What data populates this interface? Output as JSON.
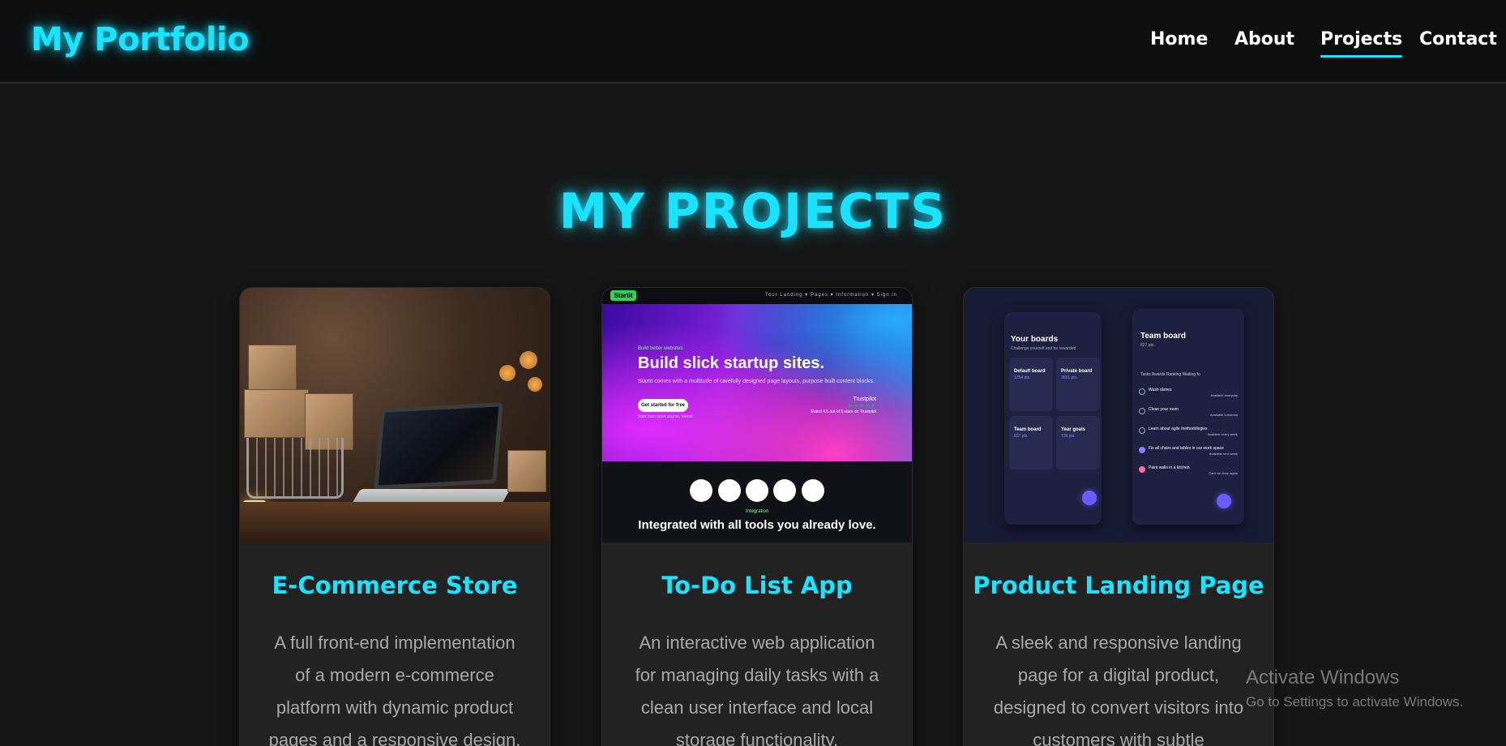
{
  "header": {
    "logo": "My Portfolio",
    "nav": [
      {
        "label": "Home",
        "active": false
      },
      {
        "label": "About",
        "active": false
      },
      {
        "label": "Projects",
        "active": true
      },
      {
        "label": "Contact",
        "active": false
      }
    ]
  },
  "section": {
    "title": "MY PROJECTS"
  },
  "projects": [
    {
      "title": "E-Commerce Store",
      "description": "A full front-end implementation of a modern e-commerce platform with dynamic product pages and a responsive design.",
      "image": "ecommerce-laptop-shopping-cart-photo"
    },
    {
      "title": "To-Do List App",
      "description": "An interactive web application for managing daily tasks with a clean user interface and local storage functionality.",
      "image": "startup-landing-page-screenshot",
      "preview": {
        "logo": "Startit",
        "links": "Tour   Landing ▾   Pages ▾   Information ▾      Sign in",
        "kicker": "Build better websites",
        "headline": "Build slick startup sites.",
        "paragraph": "Startit comes with a multitude of carefully designed page layouts, purpose built content blocks.",
        "button": "Get started for free",
        "small": "Start from open source, Vercel",
        "trust_label": "Trustpilot",
        "trust_stars": "★★★★★",
        "trust_note": "Rated 4.5 out of 5 stars on Trustpilot",
        "integration_kicker": "Integration",
        "integration_heading": "Integrated with all tools you already love."
      }
    },
    {
      "title": "Product Landing Page",
      "description": "A sleek and responsive landing page for a digital product, designed to convert visitors into customers with subtle",
      "image": "boards-app-ui-screenshot",
      "preview": {
        "left_title": "Your boards",
        "left_sub": "Challenge yourself and be rewarded",
        "boards": [
          {
            "name": "Default board",
            "pts": "1254 pts."
          },
          {
            "name": "Private board",
            "pts": "3601 pts."
          },
          {
            "name": "Team board",
            "pts": "827 pts."
          },
          {
            "name": "Year goals",
            "pts": "728 pts."
          }
        ],
        "right_title": "Team board",
        "right_sub": "827 pts.",
        "tabs": "Tasks      Awards      Ranking      Waiting fo",
        "tasks": [
          {
            "name": "Wash dishes",
            "note": "Available everyday"
          },
          {
            "name": "Clean your room",
            "note": "Available tomorrow"
          },
          {
            "name": "Learn about agile methodologies",
            "note": "Available every week"
          },
          {
            "name": "Fix all chairs and tables in our work space",
            "note": "Available next week"
          },
          {
            "name": "Paint walls in a kitchen",
            "note": "Can't be done again"
          }
        ]
      }
    }
  ],
  "watermark": {
    "line1": "Activate Windows",
    "line2": "Go to Settings to activate Windows."
  },
  "colors": {
    "accent": "#19e3ff",
    "background": "#161616",
    "header_bg": "#0e0e0e",
    "card_bg": "#222222",
    "desc_text": "#a9a9a9"
  }
}
